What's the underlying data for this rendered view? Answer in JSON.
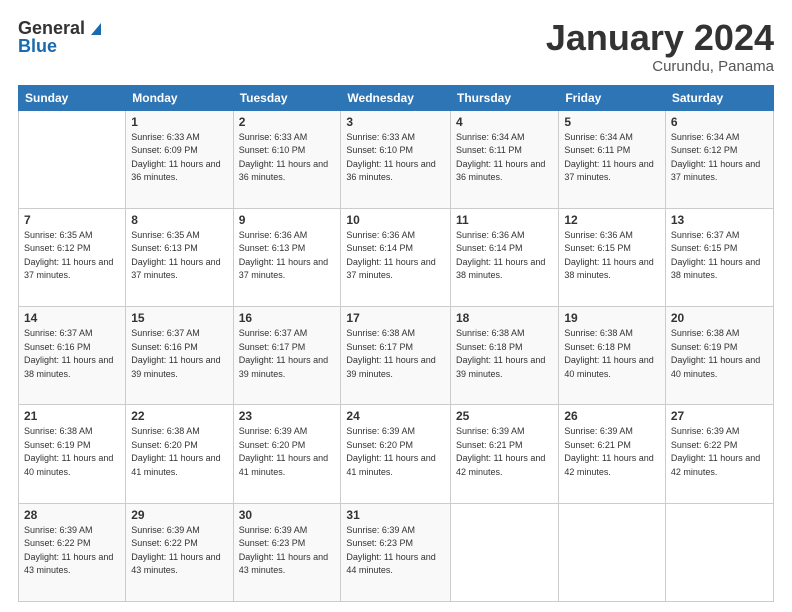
{
  "header": {
    "logo_general": "General",
    "logo_blue": "Blue",
    "title": "January 2024",
    "location": "Curundu, Panama"
  },
  "weekdays": [
    "Sunday",
    "Monday",
    "Tuesday",
    "Wednesday",
    "Thursday",
    "Friday",
    "Saturday"
  ],
  "weeks": [
    [
      {
        "day": "",
        "sunrise": "",
        "sunset": "",
        "daylight": ""
      },
      {
        "day": "1",
        "sunrise": "Sunrise: 6:33 AM",
        "sunset": "Sunset: 6:09 PM",
        "daylight": "Daylight: 11 hours and 36 minutes."
      },
      {
        "day": "2",
        "sunrise": "Sunrise: 6:33 AM",
        "sunset": "Sunset: 6:10 PM",
        "daylight": "Daylight: 11 hours and 36 minutes."
      },
      {
        "day": "3",
        "sunrise": "Sunrise: 6:33 AM",
        "sunset": "Sunset: 6:10 PM",
        "daylight": "Daylight: 11 hours and 36 minutes."
      },
      {
        "day": "4",
        "sunrise": "Sunrise: 6:34 AM",
        "sunset": "Sunset: 6:11 PM",
        "daylight": "Daylight: 11 hours and 36 minutes."
      },
      {
        "day": "5",
        "sunrise": "Sunrise: 6:34 AM",
        "sunset": "Sunset: 6:11 PM",
        "daylight": "Daylight: 11 hours and 37 minutes."
      },
      {
        "day": "6",
        "sunrise": "Sunrise: 6:34 AM",
        "sunset": "Sunset: 6:12 PM",
        "daylight": "Daylight: 11 hours and 37 minutes."
      }
    ],
    [
      {
        "day": "7",
        "sunrise": "Sunrise: 6:35 AM",
        "sunset": "Sunset: 6:12 PM",
        "daylight": "Daylight: 11 hours and 37 minutes."
      },
      {
        "day": "8",
        "sunrise": "Sunrise: 6:35 AM",
        "sunset": "Sunset: 6:13 PM",
        "daylight": "Daylight: 11 hours and 37 minutes."
      },
      {
        "day": "9",
        "sunrise": "Sunrise: 6:36 AM",
        "sunset": "Sunset: 6:13 PM",
        "daylight": "Daylight: 11 hours and 37 minutes."
      },
      {
        "day": "10",
        "sunrise": "Sunrise: 6:36 AM",
        "sunset": "Sunset: 6:14 PM",
        "daylight": "Daylight: 11 hours and 37 minutes."
      },
      {
        "day": "11",
        "sunrise": "Sunrise: 6:36 AM",
        "sunset": "Sunset: 6:14 PM",
        "daylight": "Daylight: 11 hours and 38 minutes."
      },
      {
        "day": "12",
        "sunrise": "Sunrise: 6:36 AM",
        "sunset": "Sunset: 6:15 PM",
        "daylight": "Daylight: 11 hours and 38 minutes."
      },
      {
        "day": "13",
        "sunrise": "Sunrise: 6:37 AM",
        "sunset": "Sunset: 6:15 PM",
        "daylight": "Daylight: 11 hours and 38 minutes."
      }
    ],
    [
      {
        "day": "14",
        "sunrise": "Sunrise: 6:37 AM",
        "sunset": "Sunset: 6:16 PM",
        "daylight": "Daylight: 11 hours and 38 minutes."
      },
      {
        "day": "15",
        "sunrise": "Sunrise: 6:37 AM",
        "sunset": "Sunset: 6:16 PM",
        "daylight": "Daylight: 11 hours and 39 minutes."
      },
      {
        "day": "16",
        "sunrise": "Sunrise: 6:37 AM",
        "sunset": "Sunset: 6:17 PM",
        "daylight": "Daylight: 11 hours and 39 minutes."
      },
      {
        "day": "17",
        "sunrise": "Sunrise: 6:38 AM",
        "sunset": "Sunset: 6:17 PM",
        "daylight": "Daylight: 11 hours and 39 minutes."
      },
      {
        "day": "18",
        "sunrise": "Sunrise: 6:38 AM",
        "sunset": "Sunset: 6:18 PM",
        "daylight": "Daylight: 11 hours and 39 minutes."
      },
      {
        "day": "19",
        "sunrise": "Sunrise: 6:38 AM",
        "sunset": "Sunset: 6:18 PM",
        "daylight": "Daylight: 11 hours and 40 minutes."
      },
      {
        "day": "20",
        "sunrise": "Sunrise: 6:38 AM",
        "sunset": "Sunset: 6:19 PM",
        "daylight": "Daylight: 11 hours and 40 minutes."
      }
    ],
    [
      {
        "day": "21",
        "sunrise": "Sunrise: 6:38 AM",
        "sunset": "Sunset: 6:19 PM",
        "daylight": "Daylight: 11 hours and 40 minutes."
      },
      {
        "day": "22",
        "sunrise": "Sunrise: 6:38 AM",
        "sunset": "Sunset: 6:20 PM",
        "daylight": "Daylight: 11 hours and 41 minutes."
      },
      {
        "day": "23",
        "sunrise": "Sunrise: 6:39 AM",
        "sunset": "Sunset: 6:20 PM",
        "daylight": "Daylight: 11 hours and 41 minutes."
      },
      {
        "day": "24",
        "sunrise": "Sunrise: 6:39 AM",
        "sunset": "Sunset: 6:20 PM",
        "daylight": "Daylight: 11 hours and 41 minutes."
      },
      {
        "day": "25",
        "sunrise": "Sunrise: 6:39 AM",
        "sunset": "Sunset: 6:21 PM",
        "daylight": "Daylight: 11 hours and 42 minutes."
      },
      {
        "day": "26",
        "sunrise": "Sunrise: 6:39 AM",
        "sunset": "Sunset: 6:21 PM",
        "daylight": "Daylight: 11 hours and 42 minutes."
      },
      {
        "day": "27",
        "sunrise": "Sunrise: 6:39 AM",
        "sunset": "Sunset: 6:22 PM",
        "daylight": "Daylight: 11 hours and 42 minutes."
      }
    ],
    [
      {
        "day": "28",
        "sunrise": "Sunrise: 6:39 AM",
        "sunset": "Sunset: 6:22 PM",
        "daylight": "Daylight: 11 hours and 43 minutes."
      },
      {
        "day": "29",
        "sunrise": "Sunrise: 6:39 AM",
        "sunset": "Sunset: 6:22 PM",
        "daylight": "Daylight: 11 hours and 43 minutes."
      },
      {
        "day": "30",
        "sunrise": "Sunrise: 6:39 AM",
        "sunset": "Sunset: 6:23 PM",
        "daylight": "Daylight: 11 hours and 43 minutes."
      },
      {
        "day": "31",
        "sunrise": "Sunrise: 6:39 AM",
        "sunset": "Sunset: 6:23 PM",
        "daylight": "Daylight: 11 hours and 44 minutes."
      },
      {
        "day": "",
        "sunrise": "",
        "sunset": "",
        "daylight": ""
      },
      {
        "day": "",
        "sunrise": "",
        "sunset": "",
        "daylight": ""
      },
      {
        "day": "",
        "sunrise": "",
        "sunset": "",
        "daylight": ""
      }
    ]
  ]
}
